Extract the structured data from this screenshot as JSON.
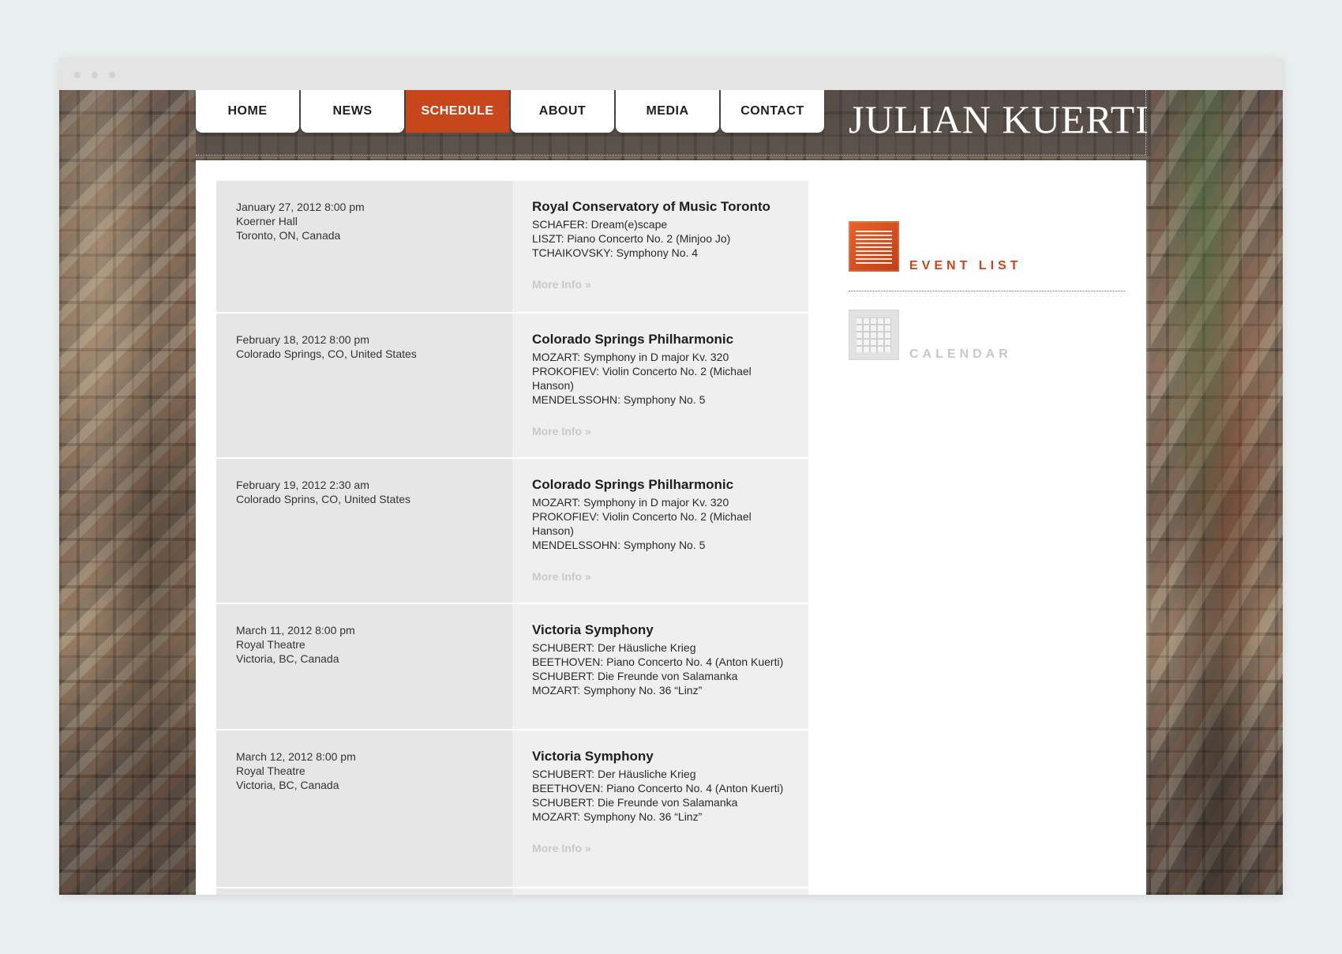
{
  "site": {
    "title": "JULIAN KUERTI"
  },
  "nav": [
    {
      "label": "HOME",
      "active": false
    },
    {
      "label": "NEWS",
      "active": false
    },
    {
      "label": "SCHEDULE",
      "active": true
    },
    {
      "label": "ABOUT",
      "active": false
    },
    {
      "label": "MEDIA",
      "active": false
    },
    {
      "label": "CONTACT",
      "active": false
    }
  ],
  "events": [
    {
      "date": "January 27, 2012 8:00 pm",
      "venue": "Koerner Hall",
      "location": "Toronto, ON, Canada",
      "title": "Royal Conservatory of Music Toronto",
      "program": [
        "SCHAFER: Dream(e)scape",
        "LISZT: Piano Concerto No. 2 (Minjoo Jo)",
        "TCHAIKOVSKY: Symphony No. 4"
      ],
      "more": "More Info »"
    },
    {
      "date": "February 18, 2012 8:00 pm",
      "venue": "",
      "location": "Colorado Springs, CO, United States",
      "title": "Colorado Springs Philharmonic",
      "program": [
        "MOZART: Symphony in D major Kv. 320",
        "PROKOFIEV: Violin Concerto No. 2 (Michael Hanson)",
        "MENDELSSOHN: Symphony No. 5"
      ],
      "more": "More Info »"
    },
    {
      "date": "February 19, 2012 2:30 am",
      "venue": "",
      "location": "Colorado Sprins, CO, United States",
      "title": "Colorado Springs Philharmonic",
      "program": [
        "MOZART: Symphony in D major Kv. 320",
        "PROKOFIEV: Violin Concerto No. 2 (Michael Hanson)",
        "MENDELSSOHN: Symphony No. 5"
      ],
      "more": "More Info »"
    },
    {
      "date": "March 11, 2012 8:00 pm",
      "venue": "Royal Theatre",
      "location": "Victoria, BC, Canada",
      "title": "Victoria Symphony",
      "program": [
        "SCHUBERT: Der Häusliche Krieg",
        "BEETHOVEN: Piano Concerto No. 4 (Anton Kuerti)",
        "SCHUBERT: Die Freunde von Salamanka",
        "MOZART: Symphony No. 36 “Linz”"
      ],
      "more": ""
    },
    {
      "date": "March 12, 2012 8:00 pm",
      "venue": "Royal Theatre",
      "location": "Victoria, BC, Canada",
      "title": "Victoria Symphony",
      "program": [
        "SCHUBERT: Der Häusliche Krieg",
        "BEETHOVEN: Piano Concerto No. 4 (Anton Kuerti)",
        "SCHUBERT: Die Freunde von Salamanka",
        "MOZART: Symphony No. 36 “Linz”"
      ],
      "more": "More Info »"
    }
  ],
  "sidebar": {
    "event_list_label": "EVENT LIST",
    "calendar_label": "CALENDAR"
  },
  "colors": {
    "accent": "#c8461c",
    "muted": "#c8c8c8"
  }
}
